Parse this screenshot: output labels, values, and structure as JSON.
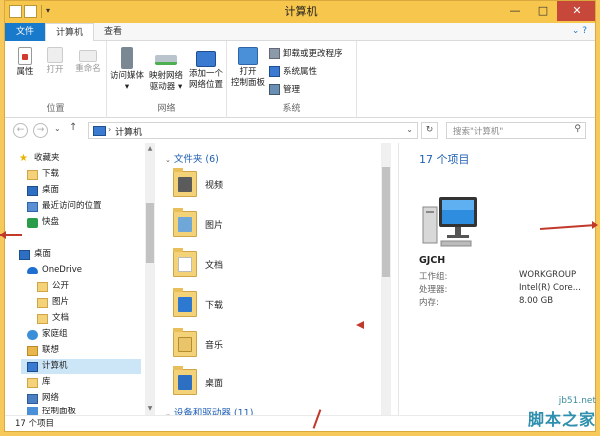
{
  "window": {
    "title": "计算机",
    "minimize": "—",
    "maximize": "□",
    "close": "✕"
  },
  "ribbon": {
    "tabs": [
      "文件",
      "计算机",
      "查看"
    ],
    "collapse": "⌄ ?",
    "groups": {
      "location": {
        "name": "位置",
        "buttons": [
          "属性",
          "打开",
          "重命名"
        ]
      },
      "network": {
        "name": "网络",
        "buttons": [
          {
            "line1": "访问媒体",
            "line2": "▾"
          },
          {
            "line1": "映射网络",
            "line2": "驱动器 ▾"
          },
          {
            "line1": "添加一个",
            "line2": "网络位置"
          }
        ]
      },
      "system": {
        "name": "系统",
        "open_cp": {
          "line1": "打开",
          "line2": "控制面板"
        },
        "small": [
          "卸载或更改程序",
          "系统属性",
          "管理"
        ]
      }
    }
  },
  "nav": {
    "back": "←",
    "forward": "→",
    "dropdown": "⌄",
    "up": "↑",
    "chevron": "›",
    "breadcrumb": "计算机",
    "address_dropdown": "⌄",
    "refresh": "↻",
    "search_placeholder": "搜索\"计算机\"",
    "search_icon": "⚲"
  },
  "sidebar": {
    "items": [
      {
        "label": "收藏夹",
        "icon": "star-icon"
      },
      {
        "label": "下载",
        "icon": "download-folder-icon"
      },
      {
        "label": "桌面",
        "icon": "desktop-icon"
      },
      {
        "label": "最近访问的位置",
        "icon": "recent-places-icon"
      },
      {
        "label": "快盘",
        "icon": "kuaipan-icon"
      },
      {
        "label": "桌面",
        "icon": "desktop-icon"
      },
      {
        "label": "OneDrive",
        "icon": "onedrive-icon"
      },
      {
        "label": "公开",
        "icon": "folder-icon"
      },
      {
        "label": "图片",
        "icon": "folder-icon"
      },
      {
        "label": "文档",
        "icon": "folder-icon"
      },
      {
        "label": "家庭组",
        "icon": "homegroup-icon"
      },
      {
        "label": "联想",
        "icon": "user-icon"
      },
      {
        "label": "计算机",
        "icon": "computer-icon"
      },
      {
        "label": "库",
        "icon": "library-icon"
      },
      {
        "label": "网络",
        "icon": "network-icon"
      },
      {
        "label": "控制面板",
        "icon": "control-panel-icon"
      }
    ]
  },
  "content": {
    "folders_header": "文件夹 (6)",
    "folders": [
      "视频",
      "图片",
      "文档",
      "下载",
      "音乐",
      "桌面"
    ],
    "devices_header": "设备和驱动器 (11)"
  },
  "details": {
    "count": "17 个项目",
    "name": "GJCH",
    "rows": [
      {
        "key": "工作组:",
        "value": "WORKGROUP"
      },
      {
        "key": "处理器:",
        "value": "Intel(R) Core..."
      },
      {
        "key": "内存:",
        "value": "8.00 GB"
      }
    ]
  },
  "status": {
    "count": "17 个项目"
  },
  "watermark": {
    "url": "jb51.net",
    "brand": "脚本之家"
  },
  "colors": {
    "titlebar": "#f7c64c",
    "file_tab": "#1979ca",
    "accent_text": "#1e5fb3",
    "selection": "#cce6f8",
    "folder": "#f3d27a",
    "annotation_red": "#c0392b"
  }
}
